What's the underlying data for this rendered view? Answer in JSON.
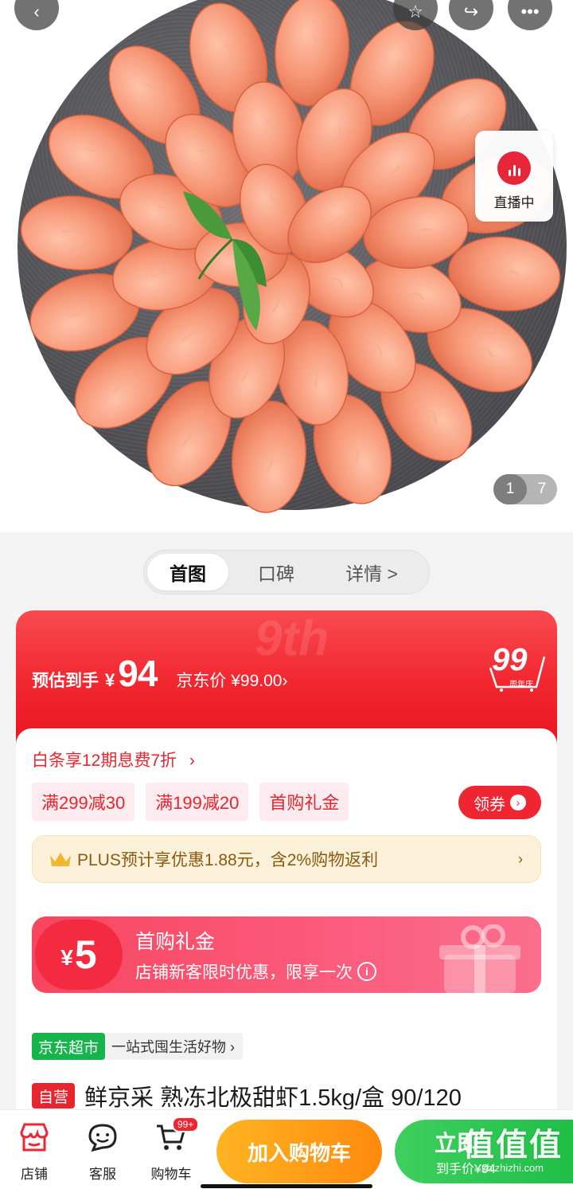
{
  "gallery": {
    "live_label": "直播中",
    "page_current": "1",
    "page_total": "7",
    "icons": [
      "back-icon",
      "favorite-icon",
      "share-icon",
      "more-icon"
    ]
  },
  "tabs": [
    {
      "label": "首图",
      "active": true
    },
    {
      "label": "口碑",
      "active": false
    },
    {
      "label": "详情 >",
      "active": false
    }
  ],
  "price": {
    "estimate_label": "预估到手",
    "currency": "¥",
    "estimate_value": "94",
    "jd_price_text": "京东价 ¥99.00",
    "jd_price_chevron": "›",
    "badge_number": "99",
    "badge_caption": "周年庆",
    "watermark": "9th"
  },
  "promo": {
    "baitiao_text": "白条享12期息费7折",
    "baitiao_chevron": "›",
    "chips": [
      "满299减30",
      "满199减20",
      "首购礼金"
    ],
    "coupon_button": "领券",
    "plus_text": "PLUS预计享优惠1.88元，含2%购物返利",
    "plus_chevron": "›"
  },
  "gift": {
    "currency": "¥",
    "amount": "5",
    "title": "首购礼金",
    "subtitle": "店铺新客限时优惠，限享一次"
  },
  "product": {
    "store_badge": "京东超市",
    "store_slogan": "一站式囤生活好物 ›",
    "self_operated_tag": "自营",
    "title": "鲜京采 熟冻北极甜虾1.5kg/盒 90/120"
  },
  "bottom_bar": {
    "store": "店铺",
    "service": "客服",
    "cart": "购物车",
    "cart_badge": "99+",
    "add_to_cart": "加入购物车",
    "buy_now_line1": "立即",
    "buy_now_line2": "到手价¥94"
  },
  "watermark": {
    "brand": "值值值",
    "url": "zhizhizhi.com"
  },
  "colors": {
    "brand_red": "#f02532",
    "plus_gold": "#8a5a12",
    "add_cart_orange": "#ff9a16",
    "buy_green": "#1fbf47",
    "store_green": "#16b54b"
  }
}
